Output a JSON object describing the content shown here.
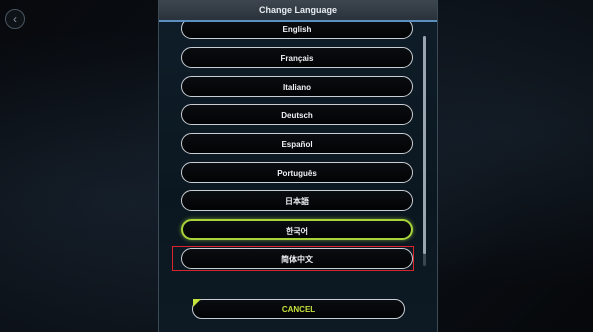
{
  "dialog": {
    "title": "Change Language",
    "languages": [
      {
        "label": "English",
        "selected": false
      },
      {
        "label": "Français",
        "selected": false
      },
      {
        "label": "Italiano",
        "selected": false
      },
      {
        "label": "Deutsch",
        "selected": false
      },
      {
        "label": "Español",
        "selected": false
      },
      {
        "label": "Português",
        "selected": false
      },
      {
        "label": "日本語",
        "selected": false
      },
      {
        "label": "한국어",
        "selected": true
      },
      {
        "label": "简体中文",
        "selected": false
      }
    ],
    "cancel_label": "CANCEL"
  },
  "colors": {
    "selected_border": "#a8d43a",
    "cancel_text": "#c4e23c",
    "highlight": "#d6252c",
    "title_underline": "#5a8fc0"
  },
  "icons": {
    "back": "chevron-left-icon"
  }
}
